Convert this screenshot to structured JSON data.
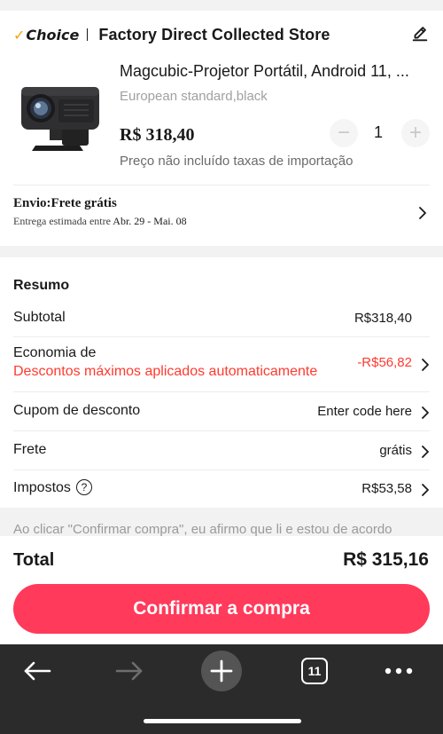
{
  "store": {
    "choice_label": "Choice",
    "name": "Factory Direct Collected Store"
  },
  "product": {
    "title": "Magcubic-Projetor Portátil, Android 11, ...",
    "variant": "European standard,black",
    "price": "R$ 318,40",
    "quantity": "1",
    "import_note": "Preço não incluído taxas de importação",
    "minus_label": "−",
    "plus_label": "+"
  },
  "shipping": {
    "title": "Envio:Frete grátis",
    "estimate_prefix": "Entrega estimada entre",
    "estimate_dates": "Abr. 29 - Mai. 08"
  },
  "summary": {
    "title": "Resumo",
    "subtotal_label": "Subtotal",
    "subtotal_value": "R$318,40",
    "savings_label": "Economia de",
    "savings_note": "Descontos máximos aplicados automaticamente",
    "savings_value": "-R$56,82",
    "coupon_label": "Cupom de desconto",
    "coupon_value": "Enter code here",
    "shipping_label": "Frete",
    "shipping_value": "grátis",
    "taxes_label": "Impostos",
    "taxes_value": "R$53,58"
  },
  "terms": {
    "text": "Ao clicar \"Confirmar compra\", eu afirmo que li e estou de acordo"
  },
  "footer": {
    "total_label": "Total",
    "total_value": "R$ 315,16",
    "confirm_label": "Confirmar a compra"
  },
  "browser": {
    "tab_count": "11"
  },
  "colors": {
    "accent_red": "#ff3a5b",
    "discount_red": "#ff3a2f",
    "choice_check": "#f4a300",
    "browser_bar": "#2b2b2b"
  },
  "icons": [
    "check-icon",
    "edit-icon",
    "chevron-right-icon",
    "help-icon",
    "back-arrow-icon",
    "forward-arrow-icon",
    "new-tab-plus-icon",
    "tabs-icon",
    "more-dots-icon"
  ]
}
